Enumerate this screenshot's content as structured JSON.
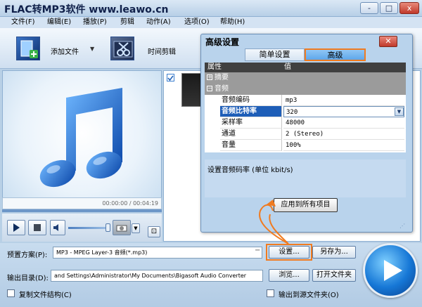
{
  "window": {
    "title": "FLAC转MP3软件 www.leawo.cn",
    "minimize": "-",
    "maximize": "□",
    "close": "x"
  },
  "menu": {
    "items": [
      "文件(F)",
      "编辑(E)",
      "播放(P)",
      "剪辑",
      "动作(A)",
      "选项(O)",
      "帮助(H)"
    ]
  },
  "toolbar": {
    "add_file": "添加文件",
    "add_file_arrow": "▼",
    "time_edit": "时间剪辑"
  },
  "player": {
    "time": "00:00:00 / 00:04:19"
  },
  "bottom": {
    "preset_label": "预置方案(P):",
    "preset_value": "MP3 - MPEG Layer-3 音频(*.mp3)",
    "settings_button": "设置...",
    "save_as_button": "另存为...",
    "output_label": "输出目录(D):",
    "output_value": "and Settings\\Administrator\\My Documents\\Bigasoft Audio Converter",
    "browse_button": "浏览...",
    "open_folder_button": "打开文件夹",
    "copy_structure": "复制文件结构(C)",
    "output_to_source": "输出到源文件夹(O)"
  },
  "dialog": {
    "title": "高级设置",
    "tabs": [
      "简单设置",
      "高级"
    ],
    "header_property": "属性",
    "header_value": "值",
    "categories": [
      "摘要",
      "音频"
    ],
    "rows": [
      {
        "name": "音频编码",
        "value": "mp3"
      },
      {
        "name": "音频比特率",
        "value": "320"
      },
      {
        "name": "采样率",
        "value": "48000"
      },
      {
        "name": "通道",
        "value": "2 (Stereo)"
      },
      {
        "name": "音量",
        "value": "100%"
      }
    ],
    "description": "设置音频码率 (单位 kbit/s)",
    "apply_all_button": "应用到所有项目"
  },
  "colors": {
    "highlight_border": "#f07b20",
    "selected_row": "#4a8fd8",
    "accent_blue": "#1e5eb8"
  }
}
